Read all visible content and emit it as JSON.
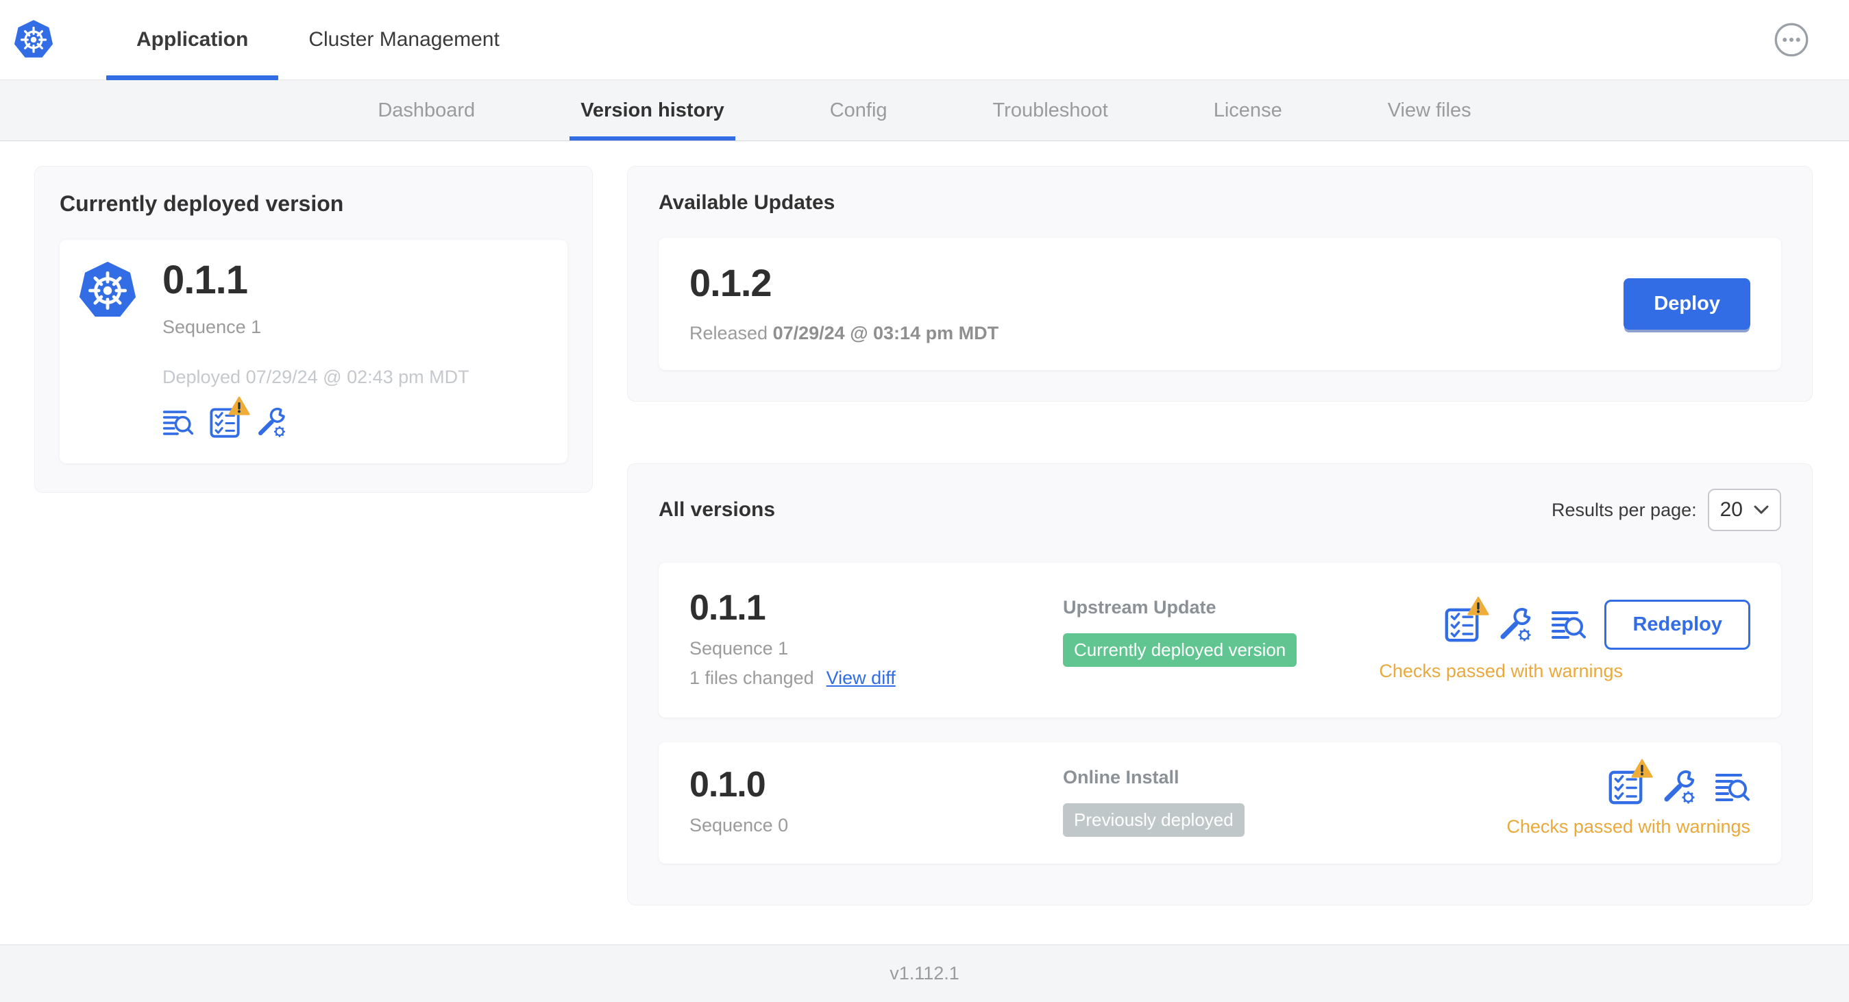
{
  "header": {
    "tabs": [
      {
        "label": "Application",
        "active": true
      },
      {
        "label": "Cluster Management",
        "active": false
      }
    ]
  },
  "nav": {
    "tabs": [
      {
        "label": "Dashboard",
        "active": false
      },
      {
        "label": "Version history",
        "active": true
      },
      {
        "label": "Config",
        "active": false
      },
      {
        "label": "Troubleshoot",
        "active": false
      },
      {
        "label": "License",
        "active": false
      },
      {
        "label": "View files",
        "active": false
      }
    ]
  },
  "currently_deployed": {
    "title": "Currently deployed version",
    "version": "0.1.1",
    "sequence": "Sequence 1",
    "deployed_at": "Deployed 07/29/24 @ 02:43 pm MDT"
  },
  "available_updates": {
    "title": "Available Updates",
    "version": "0.1.2",
    "released_label": "Released",
    "released_at": "07/29/24 @ 03:14 pm MDT",
    "deploy_label": "Deploy"
  },
  "all_versions": {
    "title": "All versions",
    "results_per_page_label": "Results per page:",
    "results_per_page_value": "20",
    "rows": [
      {
        "version": "0.1.1",
        "sequence": "Sequence 1",
        "files_changed": "1 files changed",
        "view_diff_label": "View diff",
        "source": "Upstream Update",
        "badge": "Currently deployed version",
        "badge_color": "green",
        "checks": "Checks passed with warnings",
        "action_label": "Redeploy"
      },
      {
        "version": "0.1.0",
        "sequence": "Sequence 0",
        "source": "Online Install",
        "badge": "Previously deployed",
        "badge_color": "gray",
        "checks": "Checks passed with warnings"
      }
    ]
  },
  "footer": {
    "app_version": "v1.112.1"
  },
  "icons": {
    "app_logo": "kubernetes-logo",
    "menu": "ellipsis-circle-icon",
    "logs": "logs-search-icon",
    "preflight": "preflight-checklist-icon",
    "config": "wrench-gear-icon",
    "warning": "warning-triangle-icon",
    "select_chevron": "chevron-down-icon"
  },
  "colors": {
    "accent_blue": "#326de6",
    "badge_green": "#61c591",
    "badge_gray": "#bfc7c9",
    "warning_orange": "#e9a93c",
    "nav_bg": "#f4f5f7",
    "card_bg": "#f9f9fb"
  }
}
